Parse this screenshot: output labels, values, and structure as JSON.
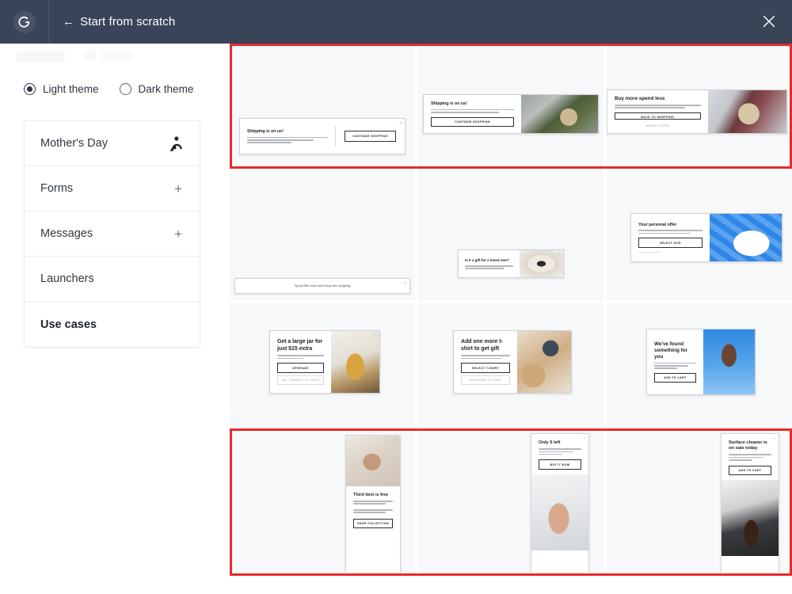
{
  "topbar": {
    "logo_icon": "brand-logo-icon",
    "back_arrow": "←",
    "back_label": "Start from scratch",
    "close_icon": "close-icon"
  },
  "sidebar": {
    "theme": {
      "options": [
        {
          "label": "Light theme",
          "selected": true
        },
        {
          "label": "Dark theme",
          "selected": false
        }
      ]
    },
    "menu": [
      {
        "label": "Mother's Day",
        "icon": "mother-child-icon",
        "bold": false
      },
      {
        "label": "Forms",
        "icon": "plus-icon",
        "bold": false
      },
      {
        "label": "Messages",
        "icon": "plus-icon",
        "bold": false
      },
      {
        "label": "Launchers",
        "icon": "",
        "bold": false
      },
      {
        "label": "Use cases",
        "icon": "",
        "bold": true
      }
    ]
  },
  "gallery": {
    "highlight_color": "#e52b2b",
    "rows": [
      {
        "highlighted": true,
        "tiles": [
          {
            "kind": "banner-split",
            "heading": "Shipping is on us!",
            "body_lines": 3,
            "button": "CONTINUE SHOPPING",
            "image": ""
          },
          {
            "kind": "banner-image-right",
            "heading": "Shipping is on us!",
            "body_lines": 2,
            "button": "CONTINUE SHOPPING",
            "image": "parcel-green-jacket"
          },
          {
            "kind": "banner-image-right",
            "heading": "Buy more spend less",
            "body_lines": 2,
            "button": "BACK TO SHOPPING",
            "secondary": "MAYBE LATER",
            "image": "parcel-taping"
          }
        ]
      },
      {
        "highlighted": false,
        "tiles": [
          {
            "kind": "strip",
            "heading": "Spend $50 more and enjoy free shipping",
            "button": "",
            "image": ""
          },
          {
            "kind": "banner-image-right",
            "heading": "Is it a gift for a loved one?",
            "body_lines": 2,
            "button": "",
            "image": "gift-box"
          },
          {
            "kind": "banner-image-right",
            "heading": "Your personal offer",
            "body_lines": 2,
            "button": "SELECT SIZE",
            "image": "blue-sneakers"
          }
        ]
      },
      {
        "highlighted": false,
        "tiles": [
          {
            "kind": "banner-image-right",
            "heading": "Get a large jar for just $15 extra",
            "body_lines": 2,
            "button": "UPGRADE",
            "secondary": "NO, THANKS I'LL PASS",
            "image": "cookie-jar"
          },
          {
            "kind": "banner-image-right",
            "heading": "Add one more t-shirt to get gift",
            "body_lines": 2,
            "button": "SELECT T-SHIRT",
            "secondary": "CONTINUE TO CART",
            "image": "tshirt-models"
          },
          {
            "kind": "banner-image-right",
            "heading": "We've found something for you",
            "body_lines": 3,
            "button": "ADD TO CART",
            "image": "portrait-blue"
          }
        ]
      },
      {
        "highlighted": true,
        "tiles": [
          {
            "kind": "vertical-image-top",
            "heading": "Third item is free",
            "body_lines": 2,
            "body_lines_2": 2,
            "button": "SHOP COLLECTION",
            "image": "woman-circle"
          },
          {
            "kind": "vertical-image-bottom",
            "heading": "Only 5 left",
            "body_lines": 3,
            "button": "BUY IT NOW",
            "image": "shoe-sparkle"
          },
          {
            "kind": "vertical-image-bottom",
            "heading": "Surface cleaner is on sale today",
            "body_lines": 3,
            "button": "ADD TO CART",
            "image": "spray-bottle"
          }
        ]
      }
    ]
  }
}
